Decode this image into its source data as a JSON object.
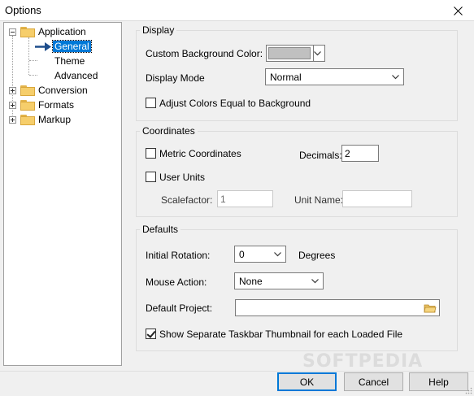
{
  "window": {
    "title": "Options"
  },
  "tree": {
    "items": [
      {
        "label": "Application",
        "expanded": true
      },
      {
        "label": "General",
        "selected": true
      },
      {
        "label": "Theme"
      },
      {
        "label": "Advanced"
      },
      {
        "label": "Conversion",
        "expanded": false
      },
      {
        "label": "Formats",
        "expanded": false
      },
      {
        "label": "Markup",
        "expanded": false
      }
    ]
  },
  "display": {
    "title": "Display",
    "custom_bg_label": "Custom Background Color:",
    "custom_bg_color": "#c0c0c0",
    "display_mode_label": "Display Mode",
    "display_mode_value": "Normal",
    "adjust_colors_label": "Adjust Colors Equal to Background",
    "adjust_colors_checked": false
  },
  "coordinates": {
    "title": "Coordinates",
    "metric_label": "Metric Coordinates",
    "metric_checked": false,
    "decimals_label": "Decimals:",
    "decimals_value": "2",
    "user_units_label": "User Units",
    "user_units_checked": false,
    "scalefactor_label": "Scalefactor:",
    "scalefactor_value": "1",
    "unit_name_label": "Unit Name:",
    "unit_name_value": ""
  },
  "defaults": {
    "title": "Defaults",
    "rotation_label": "Initial Rotation:",
    "rotation_value": "0",
    "degrees_label": "Degrees",
    "mouse_action_label": "Mouse Action:",
    "mouse_action_value": "None",
    "default_project_label": "Default Project:",
    "default_project_value": "",
    "taskbar_label": "Show Separate Taskbar Thumbnail for each Loaded File",
    "taskbar_checked": true
  },
  "buttons": {
    "ok": "OK",
    "cancel": "Cancel",
    "help": "Help"
  },
  "watermark": "SOFTPEDIA"
}
